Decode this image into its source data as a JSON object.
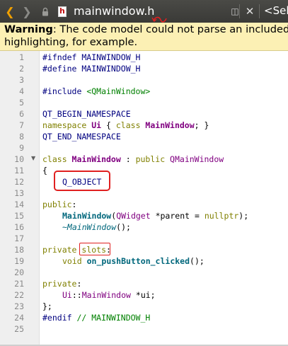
{
  "toolbar": {
    "back_glyph": "❮",
    "forward_glyph": "❯",
    "document_title": "mainwindow.h",
    "file_icon_letter": "h",
    "close_glyph": "✕",
    "select_label": "<Sele",
    "combo_glyph": "▾",
    "split_glyph": "◫"
  },
  "warning": {
    "bold_label": "Warning",
    "text_line1": ": The code model could not parse an included file, w",
    "text_line2": "highlighting, for example."
  },
  "editor": {
    "line_numbers": [
      "1",
      "2",
      "3",
      "4",
      "5",
      "6",
      "7",
      "8",
      "9",
      "10",
      "11",
      "12",
      "13",
      "14",
      "15",
      "16",
      "17",
      "18",
      "19",
      "20",
      "21",
      "22",
      "23",
      "24",
      "25"
    ],
    "fold_glyph": "▼",
    "code": {
      "l1": "#ifndef MAINWINDOW_H",
      "l2": "#define MAINWINDOW_H",
      "l4_a": "#include ",
      "l4_b": "<QMainWindow>",
      "l6": "QT_BEGIN_NAMESPACE",
      "l7_a": "namespace",
      "l7_b": " Ui ",
      "l7_c": "{ ",
      "l7_d": "class",
      "l7_e": " MainWindow",
      "l7_f": "; }",
      "l8": "QT_END_NAMESPACE",
      "l10_a": "class",
      "l10_b": " MainWindow",
      "l10_c": " : ",
      "l10_d": "public",
      "l10_e": " QMainWindow",
      "l11": "{",
      "l12": "Q_OBJECT",
      "l14_a": "public",
      "l14_b": ":",
      "l15_a": "MainWindow",
      "l15_b": "(",
      "l15_c": "QWidget",
      "l15_d": " *parent = ",
      "l15_e": "nullptr",
      "l15_f": ");",
      "l16_a": "~MainWindow",
      "l16_b": "();",
      "l18_a": "private",
      "l18_b": " ",
      "l18_c": "slots",
      "l18_d": ":",
      "l19_a": "void",
      "l19_b": " on_pushButton_clicked",
      "l19_c": "();",
      "l21_a": "private",
      "l21_b": ":",
      "l22_a": "Ui",
      "l22_b": "::",
      "l22_c": "MainWindow",
      "l22_d": " *ui;",
      "l23": "};",
      "l24_a": "#endif",
      "l24_b": " // MAINWINDOW_H"
    }
  },
  "colors": {
    "annotation_red": "#e02020",
    "warning_bg": "#fcf0b4",
    "toolbar_bg": "#3e3e3b"
  }
}
